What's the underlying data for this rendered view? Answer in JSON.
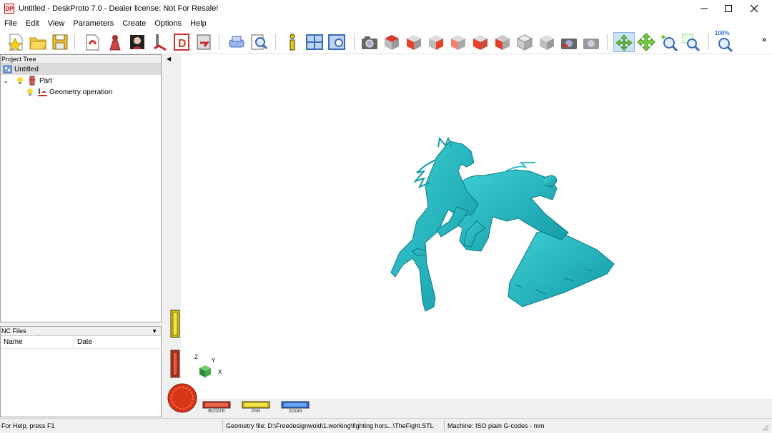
{
  "window": {
    "title": "Untitled - DeskProto 7.0 - Dealer license: Not For Resale!",
    "app_icon": "DP",
    "minimize_icon": "minimize-icon",
    "maximize_icon": "maximize-icon",
    "close_icon": "close-icon"
  },
  "menu": [
    "File",
    "Edit",
    "View",
    "Parameters",
    "Create",
    "Options",
    "Help"
  ],
  "toolbar": {
    "zoom_label": "100%",
    "more": "»"
  },
  "project_tree": {
    "header": "Project Tree",
    "root": "Untitled",
    "part": "Part",
    "operation": "Geometry operation"
  },
  "nc_files": {
    "header": "NC Files",
    "col_name": "Name",
    "col_date": "Date"
  },
  "view_controls": {
    "rotate": "ROTATE",
    "pan": "PAN",
    "zoom": "ZOOM"
  },
  "axes": {
    "z": "Z",
    "y": "Y",
    "x": "X"
  },
  "status": {
    "help": "For Help, press F1",
    "geometry": "Geometry file: D:\\Freedesignwold\\1.working\\fighting hors...\\TheFight.STL",
    "machine": "Machine: ISO plain G-codes - mm"
  },
  "colors": {
    "model": "#2ab8c0",
    "accent": "#2a6fd6",
    "window_bg": "#f0f0f0"
  }
}
